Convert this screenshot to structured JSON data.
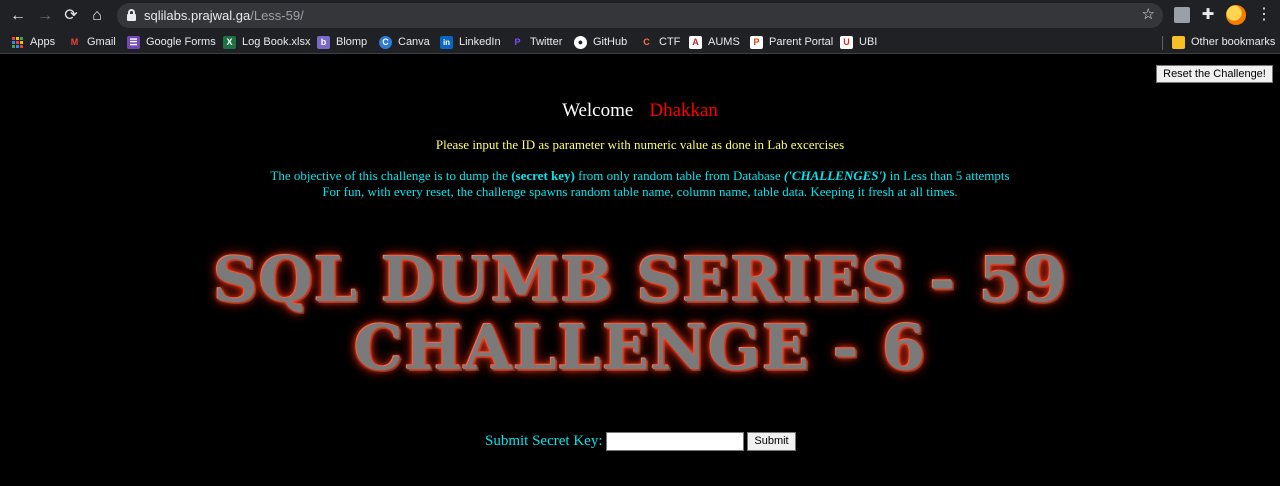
{
  "browser": {
    "url_host": "sqlilabs.prajwal.ga",
    "url_path": "/Less-59/",
    "bookmarks": [
      {
        "label": "Apps",
        "icon": "apps-grid-icon"
      },
      {
        "label": "Gmail",
        "icon": "gmail-icon",
        "color": "#ea4335",
        "glyph": "M"
      },
      {
        "label": "Google Forms",
        "icon": "google-forms-icon",
        "color": "#7248b9",
        "glyph": "☰"
      },
      {
        "label": "Log Book.xlsx",
        "icon": "excel-icon",
        "color": "#1e7145",
        "glyph": "X"
      },
      {
        "label": "Blomp",
        "icon": "blomp-icon",
        "color": "#7b68c9",
        "glyph": "b"
      },
      {
        "label": "Canva",
        "icon": "canva-icon",
        "color": "#2e7bd6",
        "glyph": "C"
      },
      {
        "label": "LinkedIn",
        "icon": "linkedin-icon",
        "color": "#0a66c2",
        "glyph": "in"
      },
      {
        "label": "Twitter",
        "icon": "twitter-icon",
        "color": "#7c4dff",
        "glyph": "P"
      },
      {
        "label": "GitHub",
        "icon": "github-icon",
        "color": "#ffffff",
        "glyph": "●"
      },
      {
        "label": "CTF",
        "icon": "ctf-icon",
        "color": "#ff7043",
        "glyph": "C"
      },
      {
        "label": "AUMS",
        "icon": "aums-icon",
        "color": "#c62828",
        "glyph": "A"
      },
      {
        "label": "Parent Portal",
        "icon": "parent-portal-icon",
        "color": "#d84315",
        "glyph": "P"
      },
      {
        "label": "UBI",
        "icon": "ubi-icon",
        "color": "#d32f2f",
        "glyph": "U"
      }
    ],
    "other_bookmarks": "Other bookmarks"
  },
  "page": {
    "reset_button": "Reset the Challenge!",
    "welcome": "Welcome",
    "username": "Dhakkan",
    "instruction": "Please input the ID as parameter with numeric value as done in Lab excercises",
    "objective_pre": "The objective of this challenge is to dump the ",
    "objective_key": "(secret key)",
    "objective_mid": " from only random table from Database ",
    "objective_db": "('CHALLENGES')",
    "objective_post": " in Less than 5 attempts",
    "fun_line": "For fun, with every reset, the challenge spawns random table name, column name, table data. Keeping it fresh at all times.",
    "banner_line1": "SQL DUMB SERIES - 59",
    "banner_line2": "CHALLENGE - 6",
    "submit_label": "Submit Secret Key:",
    "secret_value": "",
    "submit_button": "Submit"
  },
  "colors": {
    "username": "#ff0000",
    "instruction": "#ffff66",
    "objective": "#00e5ee",
    "banner_glow": "#ff4020"
  }
}
